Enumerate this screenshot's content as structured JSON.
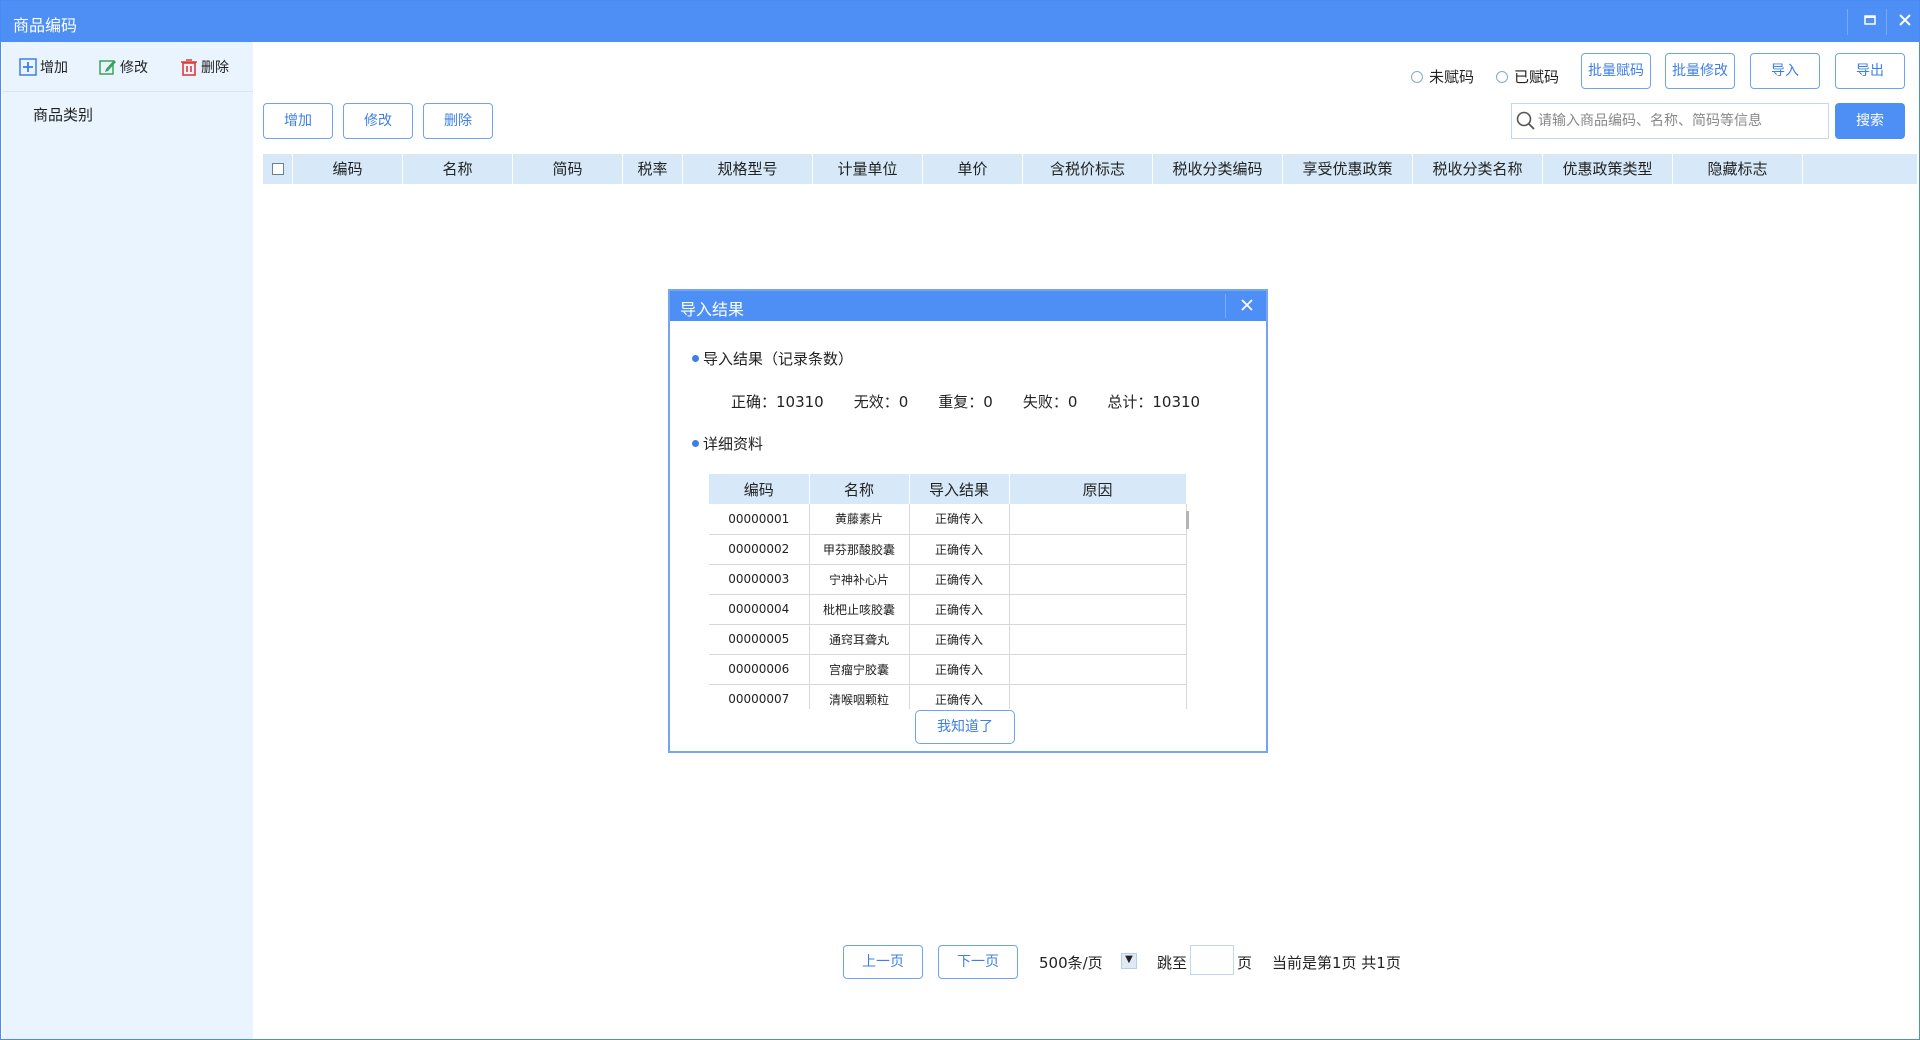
{
  "window": {
    "title": "商品编码",
    "minimize_icon": "maximize-icon",
    "close_icon": "close-icon"
  },
  "sidebar": {
    "add_label": "增加",
    "edit_label": "修改",
    "delete_label": "删除",
    "category_label": "商品类别"
  },
  "filters": {
    "unassigned": "未赋码",
    "assigned": "已赋码"
  },
  "top_buttons": {
    "batch_assign": "批量赋码",
    "batch_edit": "批量修改",
    "import": "导入",
    "export": "导出"
  },
  "toolbar": {
    "add": "增加",
    "edit": "修改",
    "delete": "删除"
  },
  "search": {
    "placeholder": "请输入商品编码、名称、简码等信息",
    "button": "搜索"
  },
  "grid": {
    "columns": [
      "编码",
      "名称",
      "简码",
      "税率",
      "规格型号",
      "计量单位",
      "单价",
      "含税价标志",
      "税收分类编码",
      "享受优惠政策",
      "税收分类名称",
      "优惠政策类型",
      "隐藏标志"
    ]
  },
  "pager": {
    "prev": "上一页",
    "next": "下一页",
    "page_size": "500条/页",
    "jump_to": "跳至",
    "page_unit": "页",
    "status": "当前是第1页 共1页"
  },
  "modal": {
    "title": "导入结果",
    "summary_title": "导入结果（记录条数）",
    "stats": {
      "correct": "正确：10310",
      "invalid": "无效：0",
      "duplicate": "重复：0",
      "failed": "失败：0",
      "total": "总计：10310"
    },
    "detail_title": "详细资料",
    "table_headers": [
      "编码",
      "名称",
      "导入结果",
      "原因"
    ],
    "rows": [
      {
        "code": "00000001",
        "name": "黄藤素片",
        "result": "正确传入",
        "reason": ""
      },
      {
        "code": "00000002",
        "name": "甲芬那酸胶囊",
        "result": "正确传入",
        "reason": ""
      },
      {
        "code": "00000003",
        "name": "宁神补心片",
        "result": "正确传入",
        "reason": ""
      },
      {
        "code": "00000004",
        "name": "枇杷止咳胶囊",
        "result": "正确传入",
        "reason": ""
      },
      {
        "code": "00000005",
        "name": "通窍耳聋丸",
        "result": "正确传入",
        "reason": ""
      },
      {
        "code": "00000006",
        "name": "宫瘤宁胶囊",
        "result": "正确传入",
        "reason": ""
      },
      {
        "code": "00000007",
        "name": "清喉咽颗粒",
        "result": "正确传入",
        "reason": ""
      }
    ],
    "ok_button": "我知道了"
  },
  "colors": {
    "accent": "#4d8ff5",
    "header_bg": "#d7e9f9",
    "sidebar_bg": "#e9f4fe"
  }
}
